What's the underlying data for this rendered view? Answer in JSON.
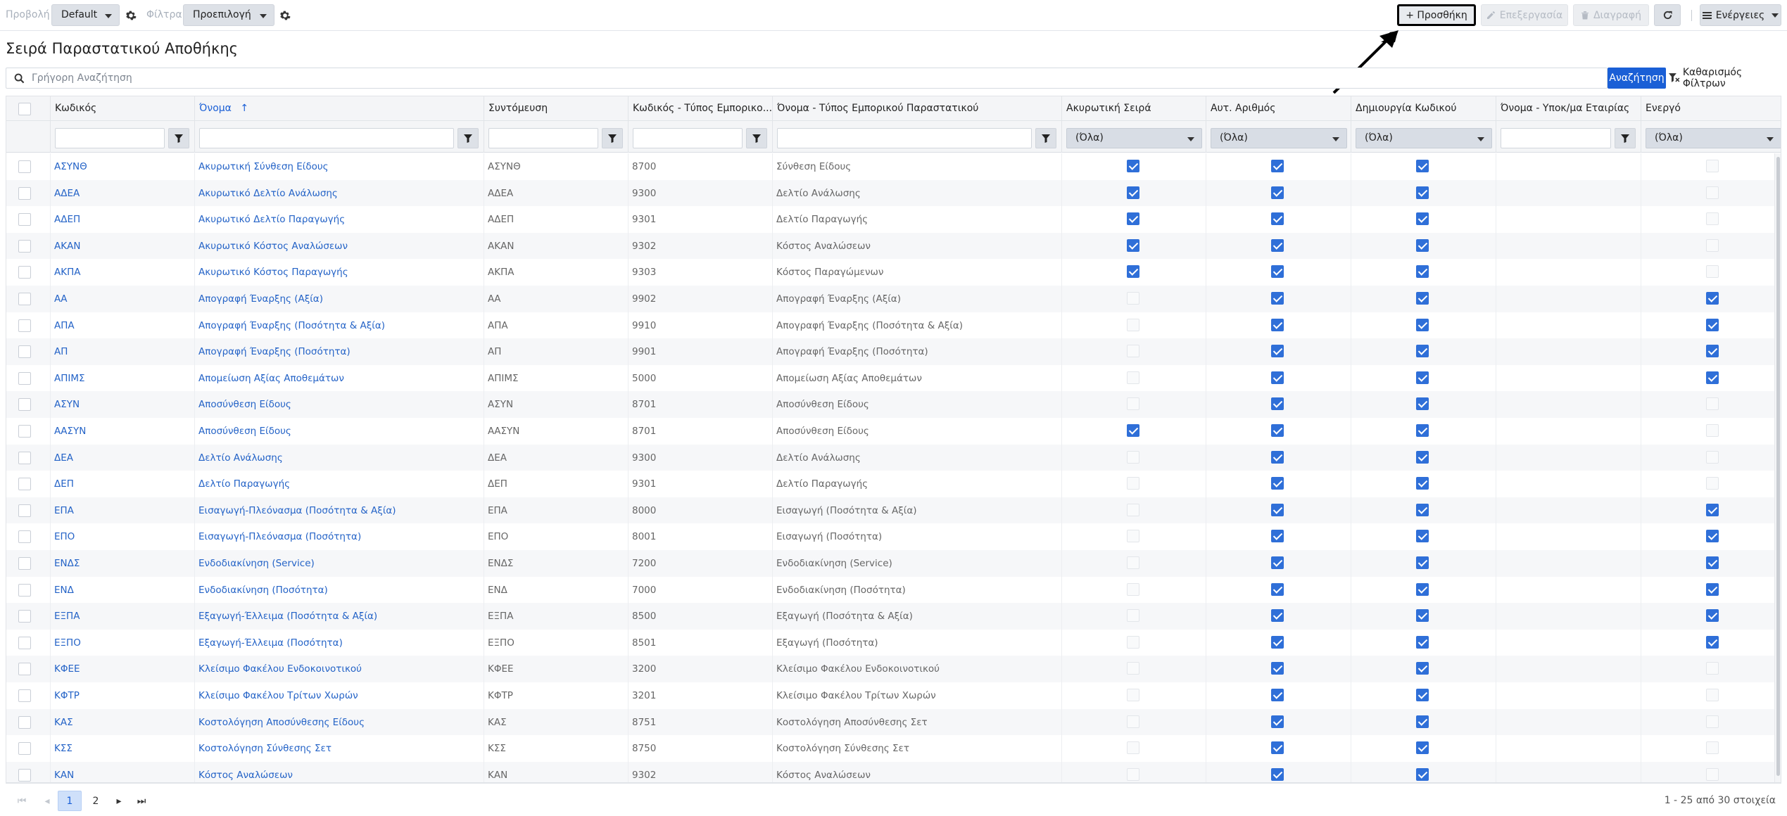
{
  "toolbar": {
    "view_label": "Προβολή",
    "view_value": "Default",
    "filters_label": "Φίλτρα",
    "filters_value": "Προεπιλογή",
    "add_label": "+ Προσθήκη",
    "edit_label": "Επεξεργασία",
    "delete_label": "Διαγραφή",
    "actions_label": "Ενέργειες"
  },
  "page": {
    "title": "Σειρά Παραστατικού Αποθήκης"
  },
  "search": {
    "placeholder": "Γρήγορη Αναζήτηση",
    "button_label": "Αναζήτηση",
    "clear_label": "Καθαρισμός Φίλτρων"
  },
  "grid": {
    "columns": [
      "Κωδικός",
      "Όνομα",
      "Συντόμευση",
      "Κωδικός - Τύπος Εμπορικο...",
      "Όνομα - Τύπος Εμπορικού Παραστατικού",
      "Ακυρωτική Σειρά",
      "Αυτ. Αριθμός",
      "Δημιουργία Κωδικού",
      "Όνομα - Υποκ/μα Εταιρίας",
      "Ενεργό"
    ],
    "sorted_column": "Όνομα",
    "filter_all_label": "(Όλα)",
    "rows": [
      {
        "code": "ΑΣΥΝΘ",
        "name": "Ακυρωτική Σύνθεση Είδους",
        "short": "ΑΣΥΝΘ",
        "type_code": "8700",
        "type_name": "Σύνθεση Είδους",
        "cancel": true,
        "auto": true,
        "create": true,
        "active": false
      },
      {
        "code": "ΑΔΕΑ",
        "name": "Ακυρωτικό Δελτίο Ανάλωσης",
        "short": "ΑΔΕΑ",
        "type_code": "9300",
        "type_name": "Δελτίο Ανάλωσης",
        "cancel": true,
        "auto": true,
        "create": true,
        "active": false
      },
      {
        "code": "ΑΔΕΠ",
        "name": "Ακυρωτικό Δελτίο Παραγωγής",
        "short": "ΑΔΕΠ",
        "type_code": "9301",
        "type_name": "Δελτίο Παραγωγής",
        "cancel": true,
        "auto": true,
        "create": true,
        "active": false
      },
      {
        "code": "ΑΚΑΝ",
        "name": "Ακυρωτικό Κόστος Αναλώσεων",
        "short": "ΑΚΑΝ",
        "type_code": "9302",
        "type_name": "Κόστος Αναλώσεων",
        "cancel": true,
        "auto": true,
        "create": true,
        "active": false
      },
      {
        "code": "ΑΚΠΑ",
        "name": "Ακυρωτικό Κόστος Παραγωγής",
        "short": "ΑΚΠΑ",
        "type_code": "9303",
        "type_name": "Κόστος Παραγώμενων",
        "cancel": true,
        "auto": true,
        "create": true,
        "active": false
      },
      {
        "code": "ΑΑ",
        "name": "Απογραφή Έναρξης (Αξία)",
        "short": "ΑΑ",
        "type_code": "9902",
        "type_name": "Απογραφή Έναρξης (Αξία)",
        "cancel": false,
        "auto": true,
        "create": true,
        "active": true
      },
      {
        "code": "ΑΠΑ",
        "name": "Απογραφή Έναρξης (Ποσότητα & Αξία)",
        "short": "ΑΠΑ",
        "type_code": "9910",
        "type_name": "Απογραφή Έναρξης (Ποσότητα & Αξία)",
        "cancel": false,
        "auto": true,
        "create": true,
        "active": true
      },
      {
        "code": "ΑΠ",
        "name": "Απογραφή Έναρξης (Ποσότητα)",
        "short": "ΑΠ",
        "type_code": "9901",
        "type_name": "Απογραφή Έναρξης (Ποσότητα)",
        "cancel": false,
        "auto": true,
        "create": true,
        "active": true
      },
      {
        "code": "ΑΠΙΜΣ",
        "name": "Απομείωση Αξίας Αποθεμάτων",
        "short": "ΑΠΙΜΣ",
        "type_code": "5000",
        "type_name": "Απομείωση Αξίας Αποθεμάτων",
        "cancel": false,
        "auto": true,
        "create": true,
        "active": true
      },
      {
        "code": "ΑΣΥΝ",
        "name": "Αποσύνθεση Είδους",
        "short": "ΑΣΥΝ",
        "type_code": "8701",
        "type_name": "Αποσύνθεση Είδους",
        "cancel": false,
        "auto": true,
        "create": true,
        "active": false
      },
      {
        "code": "ΑΑΣΥΝ",
        "name": "Αποσύνθεση Είδους",
        "short": "ΑΑΣΥΝ",
        "type_code": "8701",
        "type_name": "Αποσύνθεση Είδους",
        "cancel": true,
        "auto": true,
        "create": true,
        "active": false
      },
      {
        "code": "ΔΕΑ",
        "name": "Δελτίο Ανάλωσης",
        "short": "ΔΕΑ",
        "type_code": "9300",
        "type_name": "Δελτίο Ανάλωσης",
        "cancel": false,
        "auto": true,
        "create": true,
        "active": false
      },
      {
        "code": "ΔΕΠ",
        "name": "Δελτίο Παραγωγής",
        "short": "ΔΕΠ",
        "type_code": "9301",
        "type_name": "Δελτίο Παραγωγής",
        "cancel": false,
        "auto": true,
        "create": true,
        "active": false
      },
      {
        "code": "ΕΠΑ",
        "name": "Εισαγωγή-Πλεόνασμα (Ποσότητα & Αξία)",
        "short": "ΕΠΑ",
        "type_code": "8000",
        "type_name": "Εισαγωγή (Ποσότητα & Αξία)",
        "cancel": false,
        "auto": true,
        "create": true,
        "active": true
      },
      {
        "code": "ΕΠΟ",
        "name": "Εισαγωγή-Πλεόνασμα (Ποσότητα)",
        "short": "ΕΠΟ",
        "type_code": "8001",
        "type_name": "Εισαγωγή (Ποσότητα)",
        "cancel": false,
        "auto": true,
        "create": true,
        "active": true
      },
      {
        "code": "ΕΝΔΣ",
        "name": "Ενδοδιακίνηση (Service)",
        "short": "ΕΝΔΣ",
        "type_code": "7200",
        "type_name": "Ενδοδιακίνηση (Service)",
        "cancel": false,
        "auto": true,
        "create": true,
        "active": true
      },
      {
        "code": "ΕΝΔ",
        "name": "Ενδοδιακίνηση (Ποσότητα)",
        "short": "ΕΝΔ",
        "type_code": "7000",
        "type_name": "Ενδοδιακίνηση (Ποσότητα)",
        "cancel": false,
        "auto": true,
        "create": true,
        "active": true
      },
      {
        "code": "ΕΞΠΑ",
        "name": "Εξαγωγή-Έλλειμα (Ποσότητα & Αξία)",
        "short": "ΕΞΠΑ",
        "type_code": "8500",
        "type_name": "Εξαγωγή (Ποσότητα & Αξία)",
        "cancel": false,
        "auto": true,
        "create": true,
        "active": true
      },
      {
        "code": "ΕΞΠΟ",
        "name": "Εξαγωγή-Έλλειμα (Ποσότητα)",
        "short": "ΕΞΠΟ",
        "type_code": "8501",
        "type_name": "Εξαγωγή (Ποσότητα)",
        "cancel": false,
        "auto": true,
        "create": true,
        "active": true
      },
      {
        "code": "ΚΦΕΕ",
        "name": "Κλείσιμο Φακέλου Ενδοκοινοτικού",
        "short": "ΚΦΕΕ",
        "type_code": "3200",
        "type_name": "Κλείσιμο Φακέλου Ενδοκοινοτικού",
        "cancel": false,
        "auto": true,
        "create": true,
        "active": false
      },
      {
        "code": "ΚΦΤΡ",
        "name": "Κλείσιμο Φακέλου Τρίτων Χωρών",
        "short": "ΚΦΤΡ",
        "type_code": "3201",
        "type_name": "Κλείσιμο Φακέλου Τρίτων Χωρών",
        "cancel": false,
        "auto": true,
        "create": true,
        "active": false
      },
      {
        "code": "ΚΑΣ",
        "name": "Κοστολόγηση Αποσύνθεσης Είδους",
        "short": "ΚΑΣ",
        "type_code": "8751",
        "type_name": "Κοστολόγηση Αποσύνθεσης Σετ",
        "cancel": false,
        "auto": true,
        "create": true,
        "active": false
      },
      {
        "code": "ΚΣΣ",
        "name": "Κοστολόγηση Σύνθεσης Σετ",
        "short": "ΚΣΣ",
        "type_code": "8750",
        "type_name": "Κοστολόγηση Σύνθεσης Σετ",
        "cancel": false,
        "auto": true,
        "create": true,
        "active": false
      },
      {
        "code": "ΚΑΝ",
        "name": "Κόστος Αναλώσεων",
        "short": "ΚΑΝ",
        "type_code": "9302",
        "type_name": "Κόστος Αναλώσεων",
        "cancel": false,
        "auto": true,
        "create": true,
        "active": false
      }
    ]
  },
  "pager": {
    "pages": [
      "1",
      "2"
    ],
    "current_page": "1",
    "summary": "1 - 25 από 30 στοιχεία"
  },
  "colors": {
    "accent": "#1a5fd6",
    "link": "#2463c7",
    "checkbox_checked": "#2f6fd8"
  },
  "annotation": {
    "arrow_target": "add-button"
  }
}
